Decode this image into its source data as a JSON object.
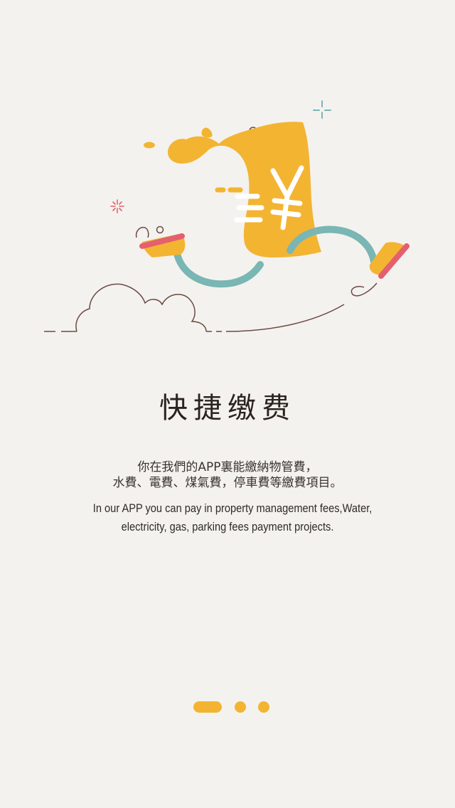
{
  "onboarding": {
    "title": "快捷缴费",
    "description_zh": [
      "你在我們的APP裏能繳納物管費，",
      "水費、電費、煤氣費，停車費等繳費項目。"
    ],
    "description_en": [
      "In our APP you can pay in property management fees,Water,",
      "electricity, gas, parking fees payment projects."
    ],
    "page_indicator": {
      "total": 3,
      "current": 1
    }
  },
  "colors": {
    "background": "#f4f2ee",
    "accent_yellow": "#f3b432",
    "accent_teal": "#79b6b4",
    "accent_pink": "#e4606e",
    "line_brown": "#6b4a44",
    "text_dark": "#2b2320"
  },
  "illustration": {
    "subject": "running-money-bag-icon",
    "symbol": "yuan-sign"
  }
}
